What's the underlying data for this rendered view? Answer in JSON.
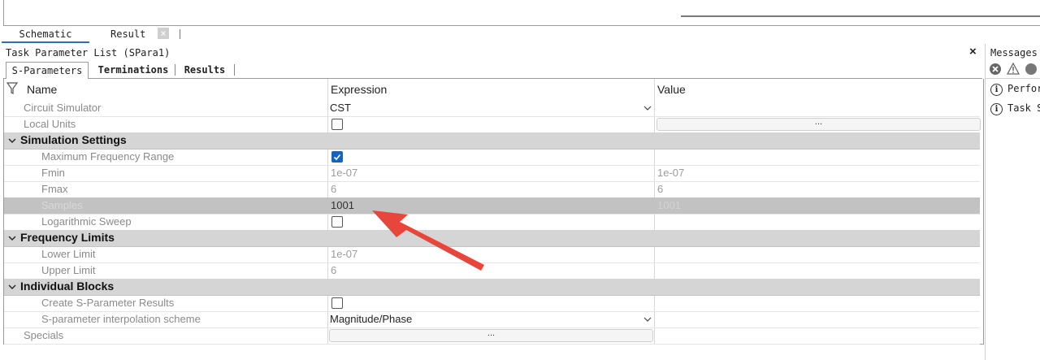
{
  "doc_tabs": {
    "schematic": "Schematic",
    "result": "Result",
    "result_close": "×"
  },
  "panel": {
    "title": "Task Parameter List (SPara1)",
    "close": "×"
  },
  "messages": {
    "title": "Messages",
    "items": [
      "Perfor",
      "Task SI"
    ]
  },
  "sub_tabs": [
    "S-Parameters",
    "Terminations",
    "Results"
  ],
  "columns": {
    "name": "Name",
    "expression": "Expression",
    "value": "Value"
  },
  "rows": {
    "circuit_simulator": {
      "name": "Circuit Simulator",
      "expression": "CST"
    },
    "local_units": {
      "name": "Local Units",
      "value_button": "..."
    },
    "simulation_settings": {
      "name": "Simulation Settings"
    },
    "max_freq_range": {
      "name": "Maximum Frequency Range",
      "checked": true
    },
    "fmin": {
      "name": "Fmin",
      "expression": "1e-07",
      "value": "1e-07"
    },
    "fmax": {
      "name": "Fmax",
      "expression": "6",
      "value": "6"
    },
    "samples": {
      "name": "Samples",
      "expression": "1001",
      "value": "1001"
    },
    "log_sweep": {
      "name": "Logarithmic Sweep",
      "checked": false
    },
    "frequency_limits": {
      "name": "Frequency Limits"
    },
    "lower_limit": {
      "name": "Lower Limit",
      "expression": "1e-07"
    },
    "upper_limit": {
      "name": "Upper Limit",
      "expression": "6"
    },
    "individual_blocks": {
      "name": "Individual Blocks"
    },
    "create_sparam_results": {
      "name": "Create S-Parameter Results",
      "checked": false
    },
    "interp_scheme": {
      "name": "S-parameter interpolation scheme",
      "expression": "Magnitude/Phase"
    },
    "specials": {
      "name": "Specials",
      "button": "..."
    }
  },
  "colors": {
    "section_bg": "#d5d5d5",
    "selected_bg": "#c2c2c2",
    "checkbox_checked": "#1565c0",
    "annotation_arrow": "#e8463a"
  }
}
